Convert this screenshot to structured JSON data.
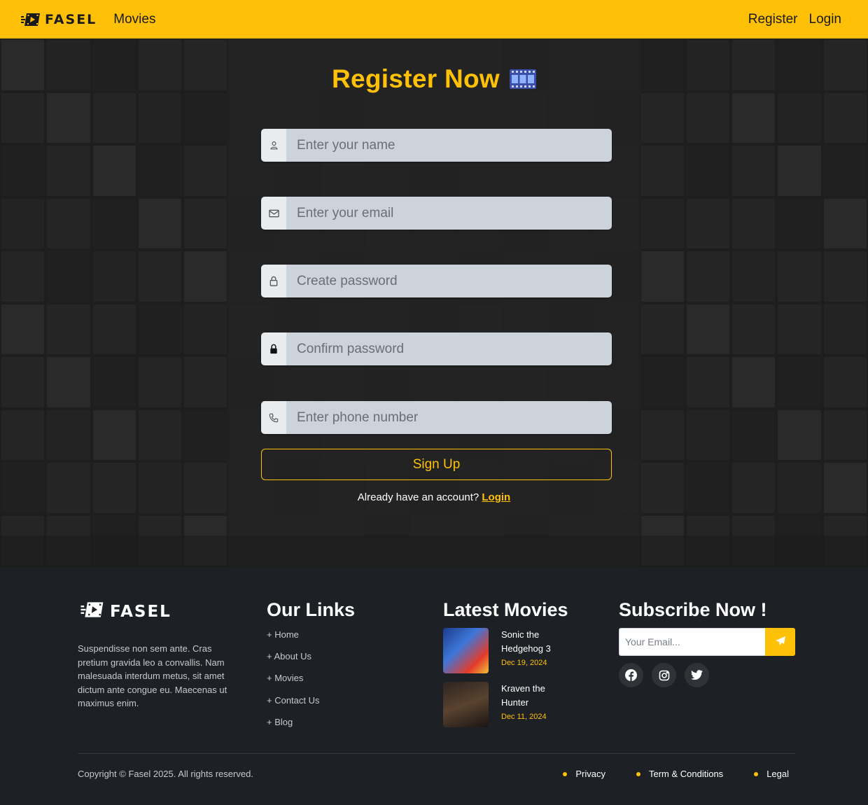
{
  "colors": {
    "accent": "#ffc107",
    "page_bg": "#1d2024",
    "navbar_bg": "#ffc107"
  },
  "navbar": {
    "brand": "FASEL",
    "links": {
      "movies": "Movies",
      "register": "Register",
      "login": "Login"
    }
  },
  "register": {
    "title": "Register Now",
    "title_icon": "film-strip-icon",
    "fields": {
      "name": {
        "placeholder": "Enter your name",
        "icon": "user-icon",
        "value": ""
      },
      "email": {
        "placeholder": "Enter your email",
        "icon": "envelope-icon",
        "value": ""
      },
      "password": {
        "placeholder": "Create password",
        "icon": "lock-outline-icon",
        "value": ""
      },
      "confirm_password": {
        "placeholder": "Confirm password",
        "icon": "lock-solid-icon",
        "value": ""
      },
      "phone": {
        "placeholder": "Enter phone number",
        "icon": "phone-icon",
        "value": ""
      }
    },
    "submit_label": "Sign Up",
    "account_text": "Already have an account?",
    "account_link": "Login"
  },
  "footer": {
    "brand": "FASEL",
    "about": "Suspendisse non sem ante. Cras pretium gravida leo a convallis. Nam malesuada interdum metus, sit amet dictum ante congue eu. Maecenas ut maximus enim.",
    "links_title": "Our Links",
    "links": [
      "+ Home",
      "+ About Us",
      "+ Movies",
      "+ Contact Us",
      "+ Blog"
    ],
    "movies_title": "Latest Movies",
    "movies": [
      {
        "title": "Sonic the Hedgehog 3",
        "date": "Dec 19, 2024"
      },
      {
        "title": "Kraven the Hunter",
        "date": "Dec 11, 2024"
      }
    ],
    "subscribe_title": "Subscribe Now !",
    "email_placeholder": "Your Email...",
    "socials": [
      "facebook-icon",
      "instagram-icon",
      "twitter-icon"
    ],
    "copyright": "Copyright © Fasel 2025. All rights reserved.",
    "legal": [
      "Privacy",
      "Term & Conditions",
      "Legal"
    ]
  }
}
